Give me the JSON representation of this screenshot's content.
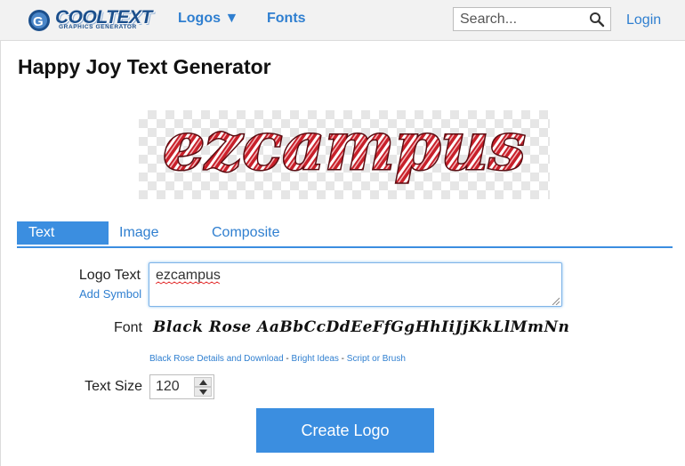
{
  "header": {
    "brand": "COOLTEXT",
    "brand_tagline": "GRAPHICS GENERATOR",
    "nav": {
      "logos_label": "Logos ▼",
      "fonts_label": "Fonts"
    },
    "search": {
      "placeholder": "Search...",
      "value": "",
      "icon": "search-icon"
    },
    "login_label": "Login"
  },
  "page": {
    "title": "Happy Joy Text Generator",
    "preview_text": "ezcampus",
    "preview_colors": {
      "stroke": "#5a0b10",
      "red": "#c8202a",
      "stripe": "#ffffff"
    }
  },
  "tabs": [
    {
      "label": "Text",
      "active": true
    },
    {
      "label": "Image",
      "active": false
    },
    {
      "label": "Composite",
      "active": false
    }
  ],
  "form": {
    "logo_text_label": "Logo Text",
    "add_symbol_label": "Add Symbol",
    "logo_text_value": "ezcampus",
    "font_label": "Font",
    "font_sample": "Black Rose AaBbCcDdEeFfGgHhIiJjKkLlMmNn",
    "font_links": {
      "details": "Black Rose Details and Download",
      "sep1": " - ",
      "bright": "Bright Ideas",
      "sep2": " - ",
      "script": "Script or Brush"
    },
    "text_size_label": "Text Size",
    "text_size_value": "120",
    "create_button": "Create Logo"
  },
  "colors": {
    "accent": "#3b8ee0",
    "link": "#2f7fd0",
    "brand": "#1b4f8c"
  }
}
